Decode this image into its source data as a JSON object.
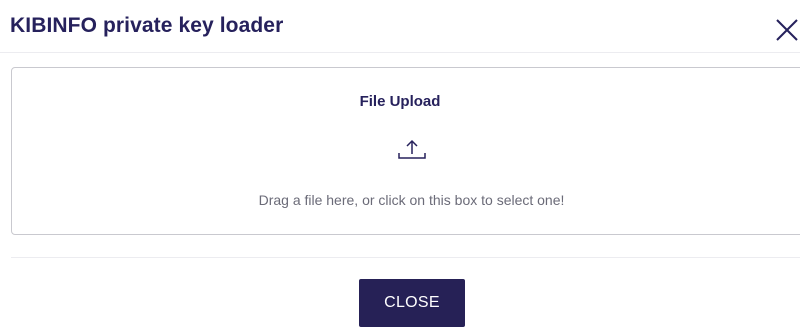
{
  "dialog": {
    "title": "KIBINFO private key loader",
    "close_icon": "close-icon"
  },
  "upload": {
    "title": "File Upload",
    "icon": "upload-icon",
    "hint": "Drag a file here, or click on this box to select one!"
  },
  "footer": {
    "close_label": "CLOSE"
  },
  "colors": {
    "primary": "#262156",
    "border": "#c9c9cf",
    "hint_text": "#6b6b78"
  }
}
